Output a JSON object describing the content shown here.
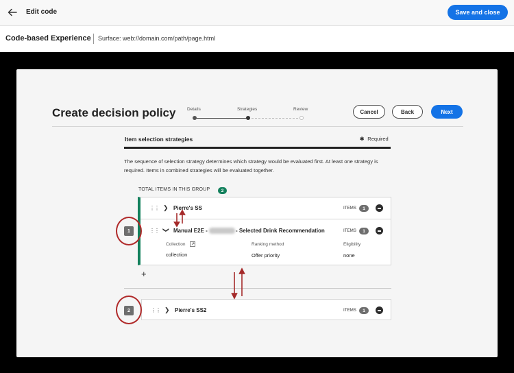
{
  "topbar": {
    "title": "Edit code",
    "save_close_label": "Save and close"
  },
  "subbar": {
    "app_title": "Code-based Experience",
    "surface": "Surface: web://domain.com/path/page.html"
  },
  "page": {
    "title": "Create decision policy"
  },
  "stepper": {
    "steps": [
      {
        "label": "Details",
        "state": "complete"
      },
      {
        "label": "Strategies",
        "state": "current"
      },
      {
        "label": "Review",
        "state": "upcoming"
      }
    ]
  },
  "actions": {
    "cancel": "Cancel",
    "back": "Back",
    "next": "Next"
  },
  "section": {
    "title": "Item selection strategies",
    "required": "Required",
    "description": "The sequence of selection strategy determines which strategy would be evaluated first. At least one strategy is required. Items in combined strategies will be evaluated together."
  },
  "group": {
    "total_label": "TOTAL ITEMS IN THIS GROUP",
    "total_count": "2",
    "strategies": [
      {
        "name": "Pierre's SS",
        "items_label": "ITEMS",
        "count": "1",
        "expanded": false
      },
      {
        "name_prefix": "Manual E2E -",
        "name_suffix": "- Selected Drink Recommendation",
        "items_label": "ITEMS",
        "count": "1",
        "expanded": true,
        "collection_label": "Collection",
        "collection_value": "collection",
        "ranking_label": "Ranking method",
        "ranking_value": "Offer priority",
        "eligibility_label": "Eligibility",
        "eligibility_value": "none"
      }
    ],
    "add": "+"
  },
  "standalone": {
    "name": "Pierre's SS2",
    "items_label": "ITEMS",
    "count": "1"
  },
  "annotations": {
    "order_1": "1",
    "order_2": "2"
  },
  "colors": {
    "accent": "#1473e6",
    "group_bar": "#12805c",
    "annotation": "#b02a2a"
  }
}
